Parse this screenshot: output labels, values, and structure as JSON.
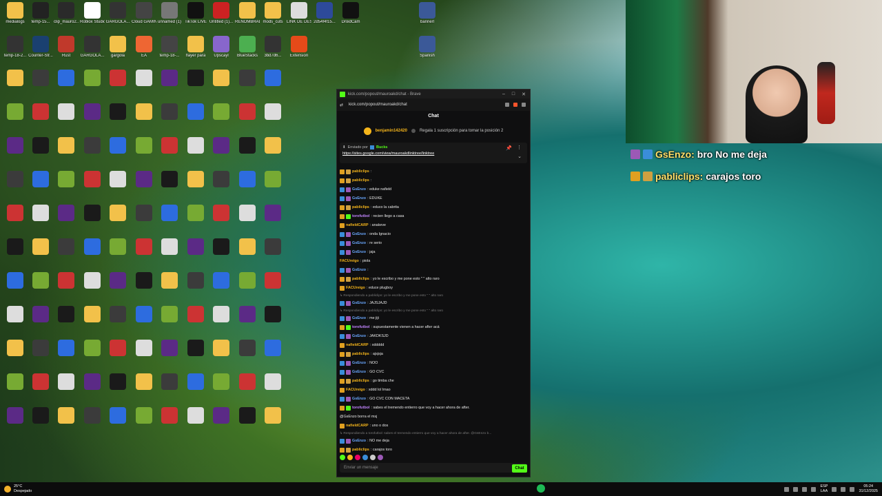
{
  "desktop": {
    "icons": [
      {
        "label": "medialogs",
        "color": "#f2c14a"
      },
      {
        "label": "temp-15...",
        "color": "#222"
      },
      {
        "label": "clip_mauro2...",
        "color": "#2a2a2a"
      },
      {
        "label": "Roblox Studio",
        "color": "#fff"
      },
      {
        "label": "GARGOLA...",
        "color": "#333"
      },
      {
        "label": "Cloud GAMING",
        "color": "#444"
      },
      {
        "label": "unnamed (1)",
        "color": "#777"
      },
      {
        "label": "TikTok LIVE",
        "color": "#111"
      },
      {
        "label": "Untitled (1)...",
        "color": "#c22"
      },
      {
        "label": "RENOMBRADO",
        "color": "#f2c14a"
      },
      {
        "label": "mods_cuts",
        "color": "#f2c14a"
      },
      {
        "label": "LINK DE DES...",
        "color": "#ddd"
      },
      {
        "label": "2d54f4f15...",
        "color": "#2d4a9a"
      },
      {
        "label": "DroidCam",
        "color": "#111"
      },
      {
        "label": "temp-18-2...",
        "color": "#333"
      },
      {
        "label": "Counter-Str...",
        "color": "#1a4070"
      },
      {
        "label": "Rust",
        "color": "#c0392b"
      },
      {
        "label": "GARGOLA...",
        "color": "#333"
      },
      {
        "label": "gargola",
        "color": "#f2c14a"
      },
      {
        "label": "EA",
        "color": "#e63"
      },
      {
        "label": "temp-18-...",
        "color": "#444"
      },
      {
        "label": "flayer para",
        "color": "#f2c14a"
      },
      {
        "label": "Upscayl",
        "color": "#8866cc"
      },
      {
        "label": "BlueStacks",
        "color": "#4caf50"
      },
      {
        "label": "3bd7d6...",
        "color": "#333"
      },
      {
        "label": "Extension",
        "color": "#e64a19"
      },
      {
        "label": "bannerl",
        "color": "#3b5998"
      },
      {
        "label": "Spanish",
        "color": "#3b5998"
      }
    ]
  },
  "browser": {
    "title": "kick.com/popout/mauroakd/chat - Brave",
    "url": "kick.com/popout/mauroakd/chat",
    "chat_header": "Chat",
    "gift": {
      "user": "benjamin142420",
      "text": "Regala 1 suscripción para tomar la posición 2"
    },
    "pinned": {
      "by_label": "Enviado por",
      "by_user": "Bucks",
      "link": "https://sites.google.com/view/mauroakdlinktree/linktree"
    },
    "messages": [
      {
        "user": "pabliclips",
        "text": ":",
        "uc": "#f5b51b",
        "bc": [
          "#e0a020",
          "#d0a040"
        ]
      },
      {
        "user": "pabliclips",
        "text": ":",
        "uc": "#f5b51b",
        "bc": [
          "#e0a020",
          "#d0a040"
        ]
      },
      {
        "user": "GsEnzo",
        "text": ": eduke nafield",
        "uc": "#6aa8ff",
        "bc": [
          "#3a8dd9",
          "#9b59b6"
        ]
      },
      {
        "user": "GsEnzo",
        "text": ": EDUKE",
        "uc": "#6aa8ff",
        "bc": [
          "#3a8dd9",
          "#9b59b6"
        ]
      },
      {
        "user": "pabliclips",
        "text": ": educo la cabrita",
        "uc": "#f5b51b",
        "bc": [
          "#e0a020",
          "#d0a040"
        ]
      },
      {
        "user": "torofutbol",
        "text": ": recien llego a casa",
        "uc": "#c084fc",
        "bc": [
          "#e0a020",
          "#53fc18"
        ]
      },
      {
        "user": "nafieldCARP",
        "text": ": anakeve",
        "uc": "#f5b51b",
        "bc": [
          "#e0a020"
        ]
      },
      {
        "user": "GsEnzo",
        "text": ": onda Ignacio",
        "uc": "#6aa8ff",
        "bc": [
          "#3a8dd9",
          "#9b59b6"
        ]
      },
      {
        "user": "GsEnzo",
        "text": ": re serio",
        "uc": "#6aa8ff",
        "bc": [
          "#3a8dd9",
          "#9b59b6"
        ]
      },
      {
        "user": "GsEnzo",
        "text": ": jaja",
        "uc": "#6aa8ff",
        "bc": [
          "#3a8dd9",
          "#9b59b6"
        ]
      },
      {
        "user": "FACUreigo",
        "text": ": piola",
        "uc": "#f5b51b",
        "bc": []
      },
      {
        "user": "GsEnzo",
        "text": ":",
        "uc": "#6aa8ff",
        "bc": [
          "#3a8dd9",
          "#9b59b6"
        ]
      },
      {
        "user": "pabliclips",
        "text": ": yo le escribo y me pone esto \" \" alto raro",
        "uc": "#f5b51b",
        "bc": [
          "#e0a020",
          "#d0a040"
        ]
      },
      {
        "user": "FACUreigo",
        "text": ": educe plugboy",
        "uc": "#f5b51b",
        "bc": [
          "#e0a020"
        ]
      },
      {
        "reply": true,
        "text": "Respondiendo a pabliclips: yo le escribo y me pone esto \" \" alto raro"
      },
      {
        "user": "GsEnzo",
        "text": ": JAJSJAJD",
        "uc": "#6aa8ff",
        "bc": [
          "#3a8dd9",
          "#9b59b6"
        ]
      },
      {
        "reply": true,
        "text": "Respondiendo a pabliclips: yo le escribo y me pone esto \" \" alto raro"
      },
      {
        "user": "GsEnzo",
        "text": ": me jiji",
        "uc": "#6aa8ff",
        "bc": [
          "#3a8dd9",
          "#9b59b6"
        ]
      },
      {
        "user": "torofutbol",
        "text": ": supuestamente vienen a hacer after acá",
        "uc": "#c084fc",
        "bc": [
          "#e0a020",
          "#53fc18"
        ]
      },
      {
        "user": "GsEnzo",
        "text": ": JAKDKSJD",
        "uc": "#6aa8ff",
        "bc": [
          "#3a8dd9",
          "#9b59b6"
        ]
      },
      {
        "user": "nafieldCARP",
        "text": ": xddddd",
        "uc": "#f5b51b",
        "bc": [
          "#e0a020"
        ]
      },
      {
        "user": "pabliclips",
        "text": ": ajsjsja",
        "uc": "#f5b51b",
        "bc": [
          "#e0a020",
          "#d0a040"
        ]
      },
      {
        "user": "GsEnzo",
        "text": ": NOO",
        "uc": "#6aa8ff",
        "bc": [
          "#3a8dd9",
          "#9b59b6"
        ]
      },
      {
        "user": "GsEnzo",
        "text": ": GO CVC",
        "uc": "#6aa8ff",
        "bc": [
          "#3a8dd9",
          "#9b59b6"
        ]
      },
      {
        "user": "pabliclips",
        "text": ": go timba che",
        "uc": "#f5b51b",
        "bc": [
          "#e0a020",
          "#d0a040"
        ]
      },
      {
        "user": "FACUreigo",
        "text": ": xddd lol lmao",
        "uc": "#f5b51b",
        "bc": [
          "#e0a020"
        ]
      },
      {
        "user": "GsEnzo",
        "text": ": GO CVC CON MACETA",
        "uc": "#6aa8ff",
        "bc": [
          "#3a8dd9",
          "#9b59b6"
        ]
      },
      {
        "user": "torofutbol",
        "text": ": sabes el tremendo entierro que voy a hacer ahora de after.",
        "uc": "#c084fc",
        "bc": [
          "#e0a020",
          "#53fc18"
        ]
      },
      {
        "user": "",
        "text": "@GsEnzo borra el msj",
        "uc": "#fff",
        "bc": []
      },
      {
        "user": "nafieldCARP",
        "text": ": uno o dos",
        "uc": "#f5b51b",
        "bc": [
          "#e0a020"
        ]
      },
      {
        "reply": true,
        "text": "Respondiendo a torofutbol: sabes el tremendo entierro que voy a hacer ahora de after. @GsEnzo b..."
      },
      {
        "user": "GsEnzo",
        "text": ": NO me deja",
        "uc": "#6aa8ff",
        "bc": [
          "#3a8dd9",
          "#9b59b6"
        ]
      },
      {
        "user": "pabliclips",
        "text": ": carajos toro",
        "uc": "#f5b51b",
        "bc": [
          "#e0a020",
          "#d0a040"
        ]
      }
    ],
    "input_placeholder": "Enviar un mensaje",
    "send_label": "Chat"
  },
  "overlay": {
    "rows": [
      {
        "user": "GsEnzo:",
        "text": "bro No me deja"
      },
      {
        "user": "pabliclips:",
        "text": "carajos toro"
      }
    ]
  },
  "taskbar": {
    "temp": "25°C",
    "weather": "Despejado",
    "lang1": "ESP",
    "lang2": "LAA",
    "time": "05:24",
    "date": "31/12/2025"
  }
}
